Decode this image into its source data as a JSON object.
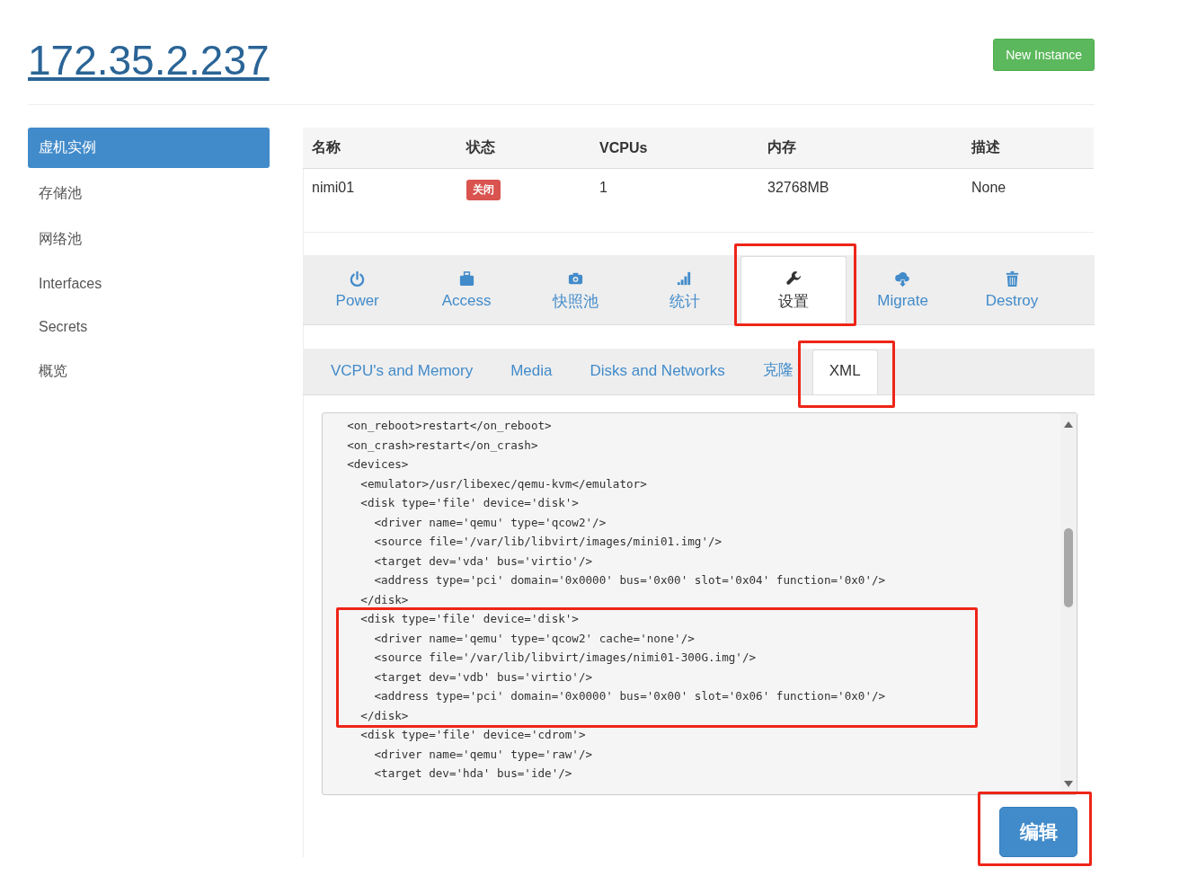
{
  "header": {
    "host": "172.35.2.237",
    "new_button": "New Instance"
  },
  "sidebar": {
    "items": [
      {
        "label": "虚机实例",
        "selected": true
      },
      {
        "label": "存储池",
        "selected": false
      },
      {
        "label": "网络池",
        "selected": false
      },
      {
        "label": "Interfaces",
        "selected": false
      },
      {
        "label": "Secrets",
        "selected": false
      },
      {
        "label": "概览",
        "selected": false
      }
    ]
  },
  "table": {
    "columns": [
      "名称",
      "状态",
      "VCPUs",
      "内存",
      "描述"
    ],
    "rows": [
      {
        "name": "nimi01",
        "status": "关闭",
        "vcpus": "1",
        "memory": "32768MB",
        "description": "None"
      }
    ]
  },
  "action_tabs": [
    {
      "label": "Power",
      "selected": false,
      "highlighted": false
    },
    {
      "label": "Access",
      "selected": false,
      "highlighted": false
    },
    {
      "label": "快照池",
      "selected": false,
      "highlighted": false
    },
    {
      "label": "统计",
      "selected": false,
      "highlighted": false
    },
    {
      "label": "设置",
      "selected": true,
      "highlighted": true
    },
    {
      "label": "Migrate",
      "selected": false,
      "highlighted": false
    },
    {
      "label": "Destroy",
      "selected": false,
      "highlighted": false
    }
  ],
  "settings_tabs": [
    {
      "label": "VCPU's and Memory",
      "selected": false,
      "highlighted": false
    },
    {
      "label": "Media",
      "selected": false,
      "highlighted": false
    },
    {
      "label": "Disks and Networks",
      "selected": false,
      "highlighted": false
    },
    {
      "label": "克隆",
      "selected": false,
      "highlighted": false
    },
    {
      "label": "XML",
      "selected": true,
      "highlighted": true
    }
  ],
  "xml_editor": {
    "blocks": [
      {
        "highlighted": false,
        "lines": [
          "  <on_reboot>restart</on_reboot>",
          "  <on_crash>restart</on_crash>",
          "  <devices>",
          "    <emulator>/usr/libexec/qemu-kvm</emulator>",
          "    <disk type='file' device='disk'>",
          "      <driver name='qemu' type='qcow2'/>",
          "      <source file='/var/lib/libvirt/images/mini01.img'/>",
          "      <target dev='vda' bus='virtio'/>",
          "      <address type='pci' domain='0x0000' bus='0x00' slot='0x04' function='0x0'/>",
          "    </disk>"
        ]
      },
      {
        "highlighted": true,
        "lines": [
          "    <disk type='file' device='disk'>",
          "      <driver name='qemu' type='qcow2' cache='none'/>",
          "      <source file='/var/lib/libvirt/images/nimi01-300G.img'/>",
          "      <target dev='vdb' bus='virtio'/>",
          "      <address type='pci' domain='0x0000' bus='0x00' slot='0x06' function='0x0'/>",
          "    </disk>"
        ]
      },
      {
        "highlighted": false,
        "lines": [
          "    <disk type='file' device='cdrom'>",
          "      <driver name='qemu' type='raw'/>",
          "      <target dev='hda' bus='ide'/>"
        ]
      }
    ]
  },
  "edit_button": {
    "label": "编辑",
    "highlighted": true
  }
}
